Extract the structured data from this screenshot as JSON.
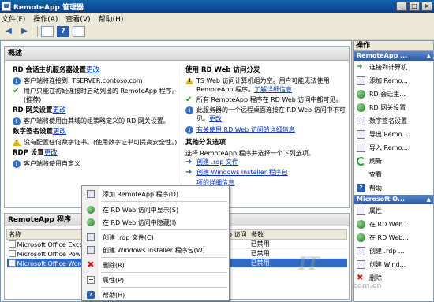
{
  "window": {
    "title": "RemoteApp 管理器"
  },
  "menu": [
    "文件(F)",
    "操作(A)",
    "查看(V)",
    "帮助(H)"
  ],
  "overview": {
    "title": "概述",
    "left": {
      "session_host": {
        "title": "RD 会话主机服务器设置",
        "link": "更改",
        "rows": [
          {
            "icon": "info",
            "text": "客户端将连接到: TSERVER.contoso.com"
          },
          {
            "icon": "check",
            "text": "用户只能在初始连接时启动列出的 RemoteApp 程序。(推荐)"
          }
        ]
      },
      "gateway": {
        "title": "RD 网关设置",
        "link": "更改",
        "rows": [
          {
            "icon": "info",
            "text": "客户端将使用由其域的组策略定义的 RD 网关设置。"
          }
        ]
      },
      "signature": {
        "title": "数字签名设置",
        "link": "更改",
        "rows": [
          {
            "icon": "warning",
            "text": "没有配置任何数字证书。(使用数字证书可提高安全性。)"
          }
        ]
      },
      "rdp": {
        "title": "RDP 设置",
        "link": "更改",
        "rows": [
          {
            "icon": "info",
            "text": "客户端将使用自定义"
          }
        ]
      }
    },
    "right": {
      "web": {
        "title": "使用 RD Web 访问分发",
        "rows": [
          {
            "icon": "warning",
            "text": "TS Web 访问计算机组为空。用户可能无法使用 RemoteApp 程序。",
            "link": "了解详细信息"
          },
          {
            "icon": "check",
            "text": "所有 RemoteApp 程序在 RD Web 访问中都可见。"
          },
          {
            "icon": "info",
            "text": "此服务器的一个远程桌面连接在 RD Web 访问中不可见。",
            "link": "更改"
          }
        ],
        "more_link": "有关使用 RD Web 访问的详细信息"
      },
      "other": {
        "title": "其他分发选项",
        "desc": "选择 RemoteApp 程序并选择一个下列选项。",
        "link_rdp": "创建 .rdp 文件",
        "link_msi": "创建 Windows Installer 程序包",
        "link_more": "项的详细信息"
      }
    }
  },
  "programs": {
    "title": "RemoteApp 程序",
    "columns": [
      "名称",
      "Web 访问",
      "参数"
    ],
    "rows": [
      {
        "name": "Microsoft Office Excel",
        "web": "是",
        "params": "已禁用"
      },
      {
        "name": "Microsoft Office Pow",
        "web": "是",
        "params": "已禁用"
      },
      {
        "name": "Microsoft Office Word",
        "web": "是",
        "params": "已禁用"
      }
    ]
  },
  "context_menu": {
    "items": [
      {
        "icon": "box",
        "label": "添加 RemoteApp 程序(D)"
      },
      {
        "icon": "globe",
        "label": "在 RD Web 访问中显示(S)"
      },
      {
        "icon": "globe",
        "label": "在 RD Web 访问中隐藏(I)"
      },
      {
        "icon": "box",
        "label": "创建 .rdp 文件(C)"
      },
      {
        "icon": "box",
        "label": "创建 Windows Installer 程序包(W)"
      },
      {
        "icon": "x",
        "label": "删除(R)"
      },
      {
        "icon": "props",
        "label": "属性(P)"
      },
      {
        "icon": "help",
        "label": "帮助(H)"
      }
    ]
  },
  "actions": {
    "title": "操作",
    "section1": "RemoteApp ...",
    "items1": [
      {
        "icon": "arrow",
        "label": "连接到计算机"
      },
      {
        "icon": "doc",
        "label": "添加 Remo..."
      },
      {
        "icon": "globe",
        "label": "RD 会话主..."
      },
      {
        "icon": "globe",
        "label": "RD 网关设置"
      },
      {
        "icon": "doc",
        "label": "数字签名设置"
      },
      {
        "icon": "doc",
        "label": "导出 Remo..."
      },
      {
        "icon": "doc",
        "label": "导入 Remo..."
      },
      {
        "icon": "refresh",
        "label": "刷新"
      },
      {
        "icon": "blank",
        "label": "查看"
      },
      {
        "icon": "help",
        "label": "帮助"
      }
    ],
    "section2": "Microsoft O...",
    "items2": [
      {
        "icon": "doc",
        "label": "属性"
      },
      {
        "icon": "globe",
        "label": "在 RD Web..."
      },
      {
        "icon": "globe",
        "label": "在 RD Web..."
      },
      {
        "icon": "doc",
        "label": "创建 .rdp ..."
      },
      {
        "icon": "doc",
        "label": "创建 Wind..."
      },
      {
        "icon": "x",
        "label": "删除"
      }
    ]
  }
}
